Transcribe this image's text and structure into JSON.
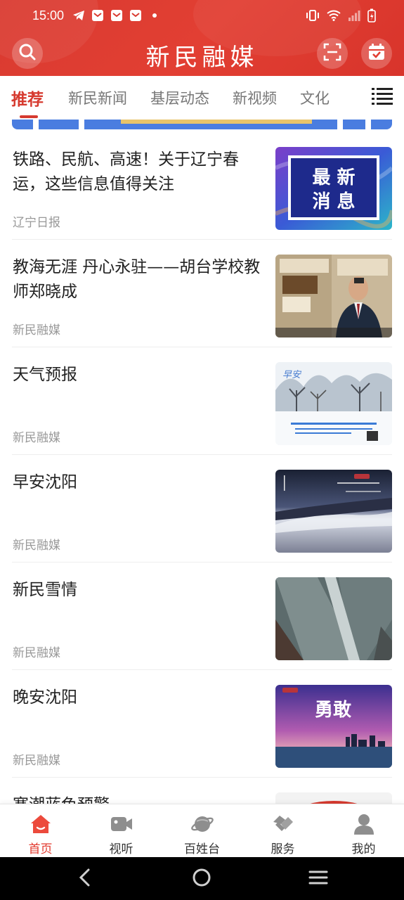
{
  "status": {
    "time": "15:00"
  },
  "header": {
    "title": "新民融媒"
  },
  "tabs": [
    {
      "label": "推荐"
    },
    {
      "label": "新民新闻"
    },
    {
      "label": "基层动态"
    },
    {
      "label": "新视频"
    },
    {
      "label": "文化"
    }
  ],
  "news": [
    {
      "title": "铁路、民航、高速！关于辽宁春运，这些信息值得关注",
      "source": "辽宁日报",
      "thumb": {
        "line1": "最 新",
        "line2": "消 息"
      }
    },
    {
      "title": "教海无涯 丹心永驻——胡台学校教师郑晓成",
      "source": "新民融媒"
    },
    {
      "title": "天气预报",
      "source": "新民融媒",
      "thumb": {
        "text": "早安"
      }
    },
    {
      "title": "早安沈阳",
      "source": "新民融媒"
    },
    {
      "title": "新民雪情",
      "source": "新民融媒"
    },
    {
      "title": "晚安沈阳",
      "source": "新民融媒",
      "thumb": {
        "text": "勇敢"
      }
    },
    {
      "title": "寒潮蓝色预警",
      "source": ""
    }
  ],
  "bottom_nav": [
    {
      "label": "首页",
      "icon": "home-icon",
      "active": true
    },
    {
      "label": "视听",
      "icon": "video-icon"
    },
    {
      "label": "百姓台",
      "icon": "planet-icon"
    },
    {
      "label": "服务",
      "icon": "service-icon"
    },
    {
      "label": "我的",
      "icon": "user-icon"
    }
  ],
  "colors": {
    "brand": "#e23f33",
    "active_tab": "#d63a2f",
    "text": "#222222",
    "muted": "#999999"
  }
}
